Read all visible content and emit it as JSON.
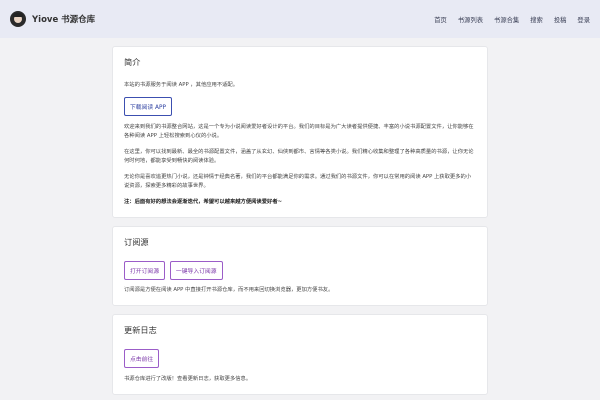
{
  "header": {
    "title": "Yiove 书源仓库",
    "nav": [
      "首页",
      "书源列表",
      "书源合集",
      "搜索",
      "投稿",
      "登录"
    ]
  },
  "intro": {
    "title": "简介",
    "note": "本站的书源服务于阅读 APP ，其他应用不适配。",
    "download_button": "下载阅读 APP",
    "p1": "欢迎来到我们的书源整合网站，这是一个专为小说阅读爱好者设计的平台。我们的目标是为广大读者提供便捷、丰富的小说书源配置文件，让你能够在各种阅读 APP 上轻松搜索到心仪的小说。",
    "p2": "在这里，你可以找到最新、最全的书源配置文件，涵盖了从玄幻、仙侠到都市、言情等各类小说。我们精心收集和整理了各种高质量的书源，让你无论何时何地，都能享受到畅快的阅读体验。",
    "p3": "无论你是喜欢追更热门小说，还是钟情于经典名著，我们的平台都能满足你的需求。通过我们的书源文件，你可以在常用的阅读 APP 上获取更多的小说资源，探索更多精彩的故事世界。",
    "p4": "注：后面有好的想法会逐渐迭代，希望可以越来越方便阅读爱好者~"
  },
  "subscribe": {
    "title": "订阅源",
    "open_button": "打开订阅源",
    "import_button": "一键导入订阅源",
    "desc": "订阅源是方便在阅读 APP 中直接打开书源仓库，而不用来回切换浏览器，更加方便书友。"
  },
  "changelog": {
    "title": "更新日志",
    "go_button": "点击前往",
    "desc": "书源仓库进行了改版！查看更新日志，获取更多信息。"
  }
}
